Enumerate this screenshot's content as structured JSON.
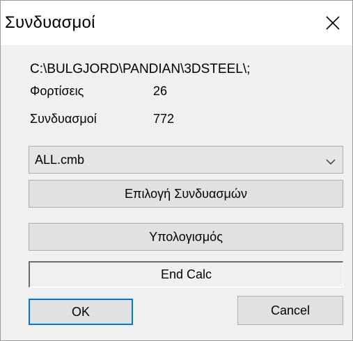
{
  "window": {
    "title": "Συνδυασμοί",
    "close_icon": "close-icon"
  },
  "info": {
    "path": "C:\\BULGJORD\\PANDIAN\\3DSTEEL\\;",
    "loads_label": "Φορτίσεις",
    "loads_value": "26",
    "combos_label": "Συνδυασμοί",
    "combos_value": "772"
  },
  "combo_file_select": {
    "selected": "ALL.cmb",
    "arrow_icon": "chevron-down-icon"
  },
  "buttons": {
    "select_combos": "Επιλογή Συνδυασμών",
    "calculate": "Υπολογισμός",
    "end_calc": "End Calc",
    "ok": "OK",
    "cancel": "Cancel"
  },
  "colors": {
    "accent_focus_border": "#0078d7",
    "dialog_background": "#f0f0f0",
    "title_background": "#ffffff"
  }
}
